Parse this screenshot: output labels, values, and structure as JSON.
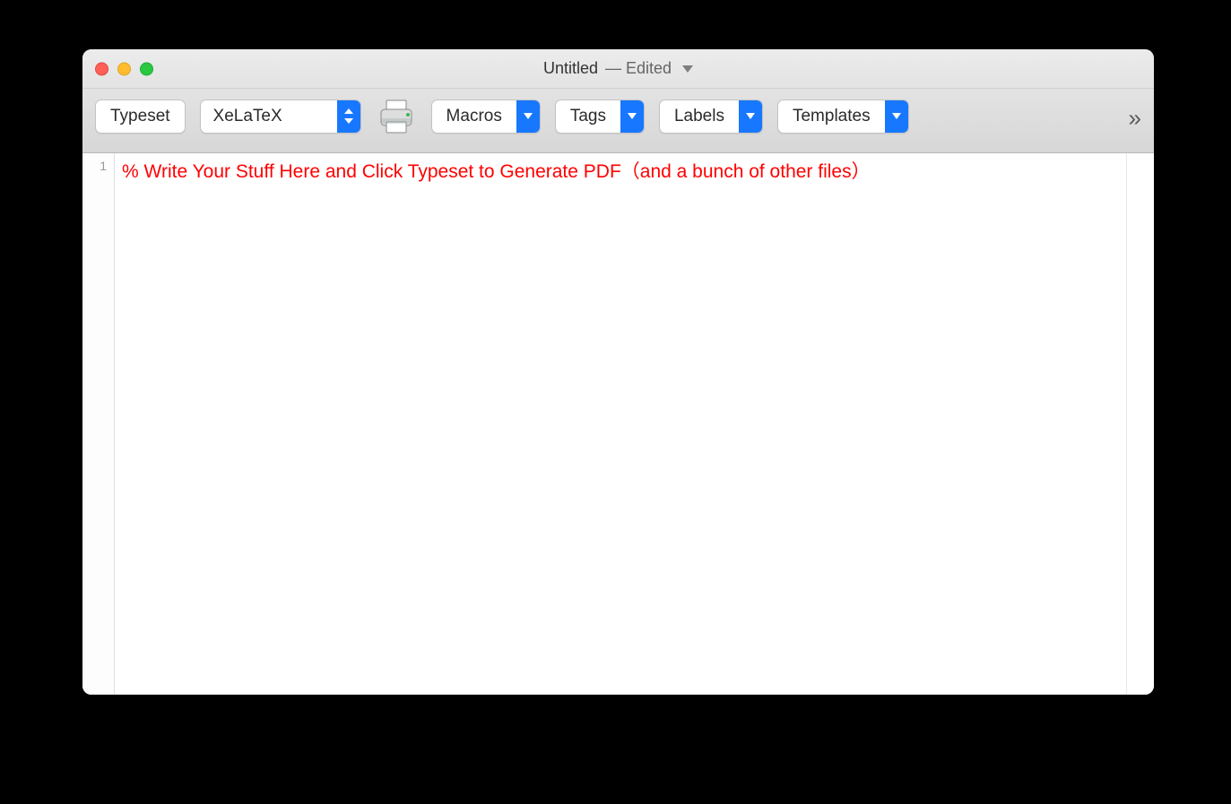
{
  "window": {
    "title_doc": "Untitled",
    "title_status": "— Edited"
  },
  "toolbar": {
    "typeset_label": "Typeset",
    "engine_selected": "XeLaTeX",
    "macros_label": "Macros",
    "tags_label": "Tags",
    "labels_label": "Labels",
    "templates_label": "Templates",
    "overflow_glyph": "»"
  },
  "editor": {
    "line_number": "1",
    "line_content": "% Write Your Stuff Here and Click Typeset to Generate PDF（and a bunch of other files）"
  }
}
